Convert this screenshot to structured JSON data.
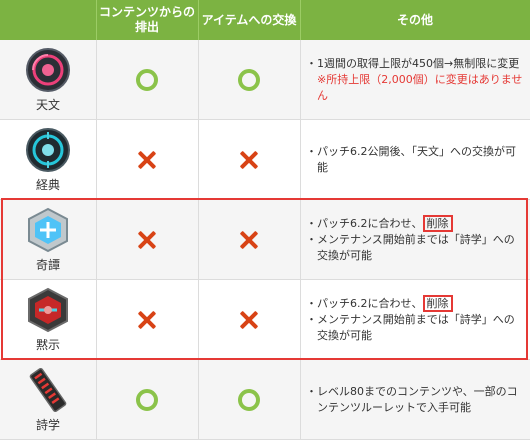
{
  "header": {
    "col_item": "",
    "col_content": "コンテンツからの\n排出",
    "col_exchange": "アイテムへの交換",
    "col_other": "その他"
  },
  "rows": [
    {
      "name": "天文",
      "icon": "tomestone-astronomy-icon",
      "content_mark": "circle",
      "exchange_mark": "circle",
      "notes": [
        {
          "text": "1週間の取得上限が450個→無制限に変更",
          "style": "normal"
        },
        {
          "text": "※所持上限（2,000個）に変更はありません",
          "style": "red"
        }
      ]
    },
    {
      "name": "経典",
      "icon": "tomestone-causality-icon",
      "content_mark": "cross",
      "exchange_mark": "cross",
      "notes": [
        {
          "text": "パッチ6.2公開後、「天文」への交換が可能",
          "style": "normal"
        }
      ]
    },
    {
      "name": "奇譚",
      "icon": "tomestone-aphorism-icon",
      "content_mark": "cross",
      "exchange_mark": "cross",
      "notes": [
        {
          "text": "パッチ6.2に合わせ、",
          "boxed": "削除",
          "style": "normal"
        },
        {
          "text": "メンテナンス開始前までは「詩学」への交換が可能",
          "style": "normal"
        }
      ]
    },
    {
      "name": "黙示",
      "icon": "tomestone-revelation-icon",
      "content_mark": "cross",
      "exchange_mark": "cross",
      "notes": [
        {
          "text": "パッチ6.2に合わせ、",
          "boxed": "削除",
          "style": "normal"
        },
        {
          "text": "メンテナンス開始前までは「詩学」への交換が可能",
          "style": "normal"
        }
      ]
    },
    {
      "name": "詩学",
      "icon": "tomestone-poetics-icon",
      "content_mark": "circle",
      "exchange_mark": "circle",
      "notes": [
        {
          "text": "レベル80までのコンテンツや、一部のコンテンツルーレットで入手可能",
          "style": "normal"
        }
      ]
    }
  ],
  "bullet": "・",
  "colors": {
    "header_bg": "#7cb342",
    "circle": "#8bc34a",
    "cross": "#d84315",
    "highlight": "#e53935"
  }
}
